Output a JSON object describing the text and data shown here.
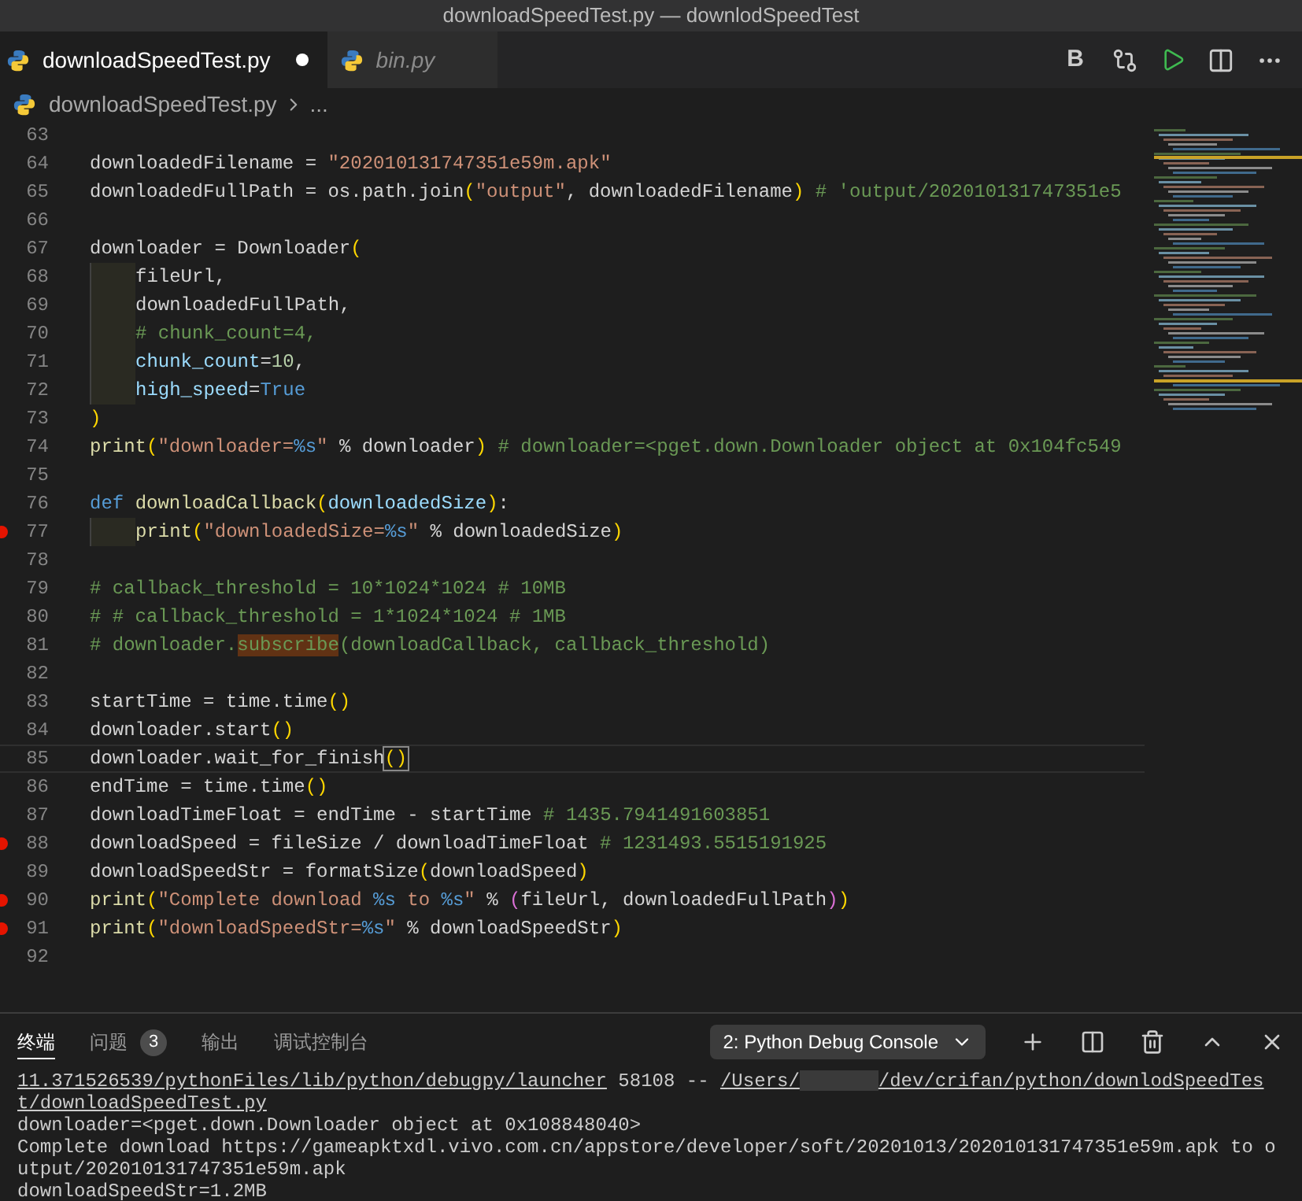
{
  "window": {
    "title": "downloadSpeedTest.py — downlodSpeedTest"
  },
  "tabs": [
    {
      "label": "downloadSpeedTest.py",
      "selected": true,
      "modified": true,
      "preview": false
    },
    {
      "label": "bin.py",
      "selected": false,
      "modified": false,
      "preview": true
    }
  ],
  "toolbar": {
    "bold_label": "B"
  },
  "breadcrumb": {
    "file": "downloadSpeedTest.py",
    "more": "..."
  },
  "editor": {
    "lines": [
      {
        "number": "63",
        "breakpoint": false,
        "current": false,
        "indent": false
      },
      {
        "number": "64",
        "breakpoint": false,
        "current": false,
        "indent": false,
        "tokens": [
          {
            "kind": "plain",
            "text": "downloadedFilename = "
          },
          {
            "kind": "string",
            "text": "\"202010131747351e59m.apk\""
          }
        ]
      },
      {
        "number": "65",
        "breakpoint": false,
        "current": false,
        "indent": false,
        "tokens": [
          {
            "kind": "plain",
            "text": "downloadedFullPath = os.path.join"
          },
          {
            "kind": "paren",
            "text": "("
          },
          {
            "kind": "string",
            "text": "\"output\""
          },
          {
            "kind": "plain",
            "text": ", downloadedFilename"
          },
          {
            "kind": "paren",
            "text": ")"
          },
          {
            "kind": "comment",
            "text": " # 'output/202010131747351e5"
          }
        ]
      },
      {
        "number": "66",
        "breakpoint": false,
        "current": false,
        "indent": false
      },
      {
        "number": "67",
        "breakpoint": false,
        "current": false,
        "indent": false,
        "tokens": [
          {
            "kind": "plain",
            "text": "downloader = Downloader"
          },
          {
            "kind": "paren",
            "text": "("
          }
        ]
      },
      {
        "number": "68",
        "breakpoint": false,
        "current": false,
        "indent": true,
        "tokens": [
          {
            "kind": "plain",
            "text": "fileUrl,"
          }
        ]
      },
      {
        "number": "69",
        "breakpoint": false,
        "current": false,
        "indent": true,
        "tokens": [
          {
            "kind": "plain",
            "text": "downloadedFullPath,"
          }
        ]
      },
      {
        "number": "70",
        "breakpoint": false,
        "current": false,
        "indent": true,
        "tokens": [
          {
            "kind": "comment",
            "text": "# chunk_count=4,"
          }
        ]
      },
      {
        "number": "71",
        "breakpoint": false,
        "current": false,
        "indent": true,
        "tokens": [
          {
            "kind": "param",
            "text": "chunk_count"
          },
          {
            "kind": "plain",
            "text": "="
          },
          {
            "kind": "number",
            "text": "10"
          },
          {
            "kind": "plain",
            "text": ","
          }
        ]
      },
      {
        "number": "72",
        "breakpoint": false,
        "current": false,
        "indent": true,
        "tokens": [
          {
            "kind": "param",
            "text": "high_speed"
          },
          {
            "kind": "plain",
            "text": "="
          },
          {
            "kind": "keyword",
            "text": "True"
          }
        ]
      },
      {
        "number": "73",
        "breakpoint": false,
        "current": false,
        "indent": false,
        "tokens": [
          {
            "kind": "paren",
            "text": ")"
          }
        ]
      },
      {
        "number": "74",
        "breakpoint": false,
        "current": false,
        "indent": false,
        "tokens": [
          {
            "kind": "func",
            "text": "print"
          },
          {
            "kind": "paren",
            "text": "("
          },
          {
            "kind": "string",
            "text": "\"downloader="
          },
          {
            "kind": "format",
            "text": "%s"
          },
          {
            "kind": "string",
            "text": "\""
          },
          {
            "kind": "plain",
            "text": " % downloader"
          },
          {
            "kind": "paren",
            "text": ")"
          },
          {
            "kind": "comment",
            "text": " # downloader=<pget.down.Downloader object at 0x104fc549"
          }
        ]
      },
      {
        "number": "75",
        "breakpoint": false,
        "current": false,
        "indent": false
      },
      {
        "number": "76",
        "breakpoint": false,
        "current": false,
        "indent": false,
        "tokens": [
          {
            "kind": "keyword",
            "text": "def "
          },
          {
            "kind": "func",
            "text": "downloadCallback"
          },
          {
            "kind": "paren",
            "text": "("
          },
          {
            "kind": "param",
            "text": "downloadedSize"
          },
          {
            "kind": "paren",
            "text": ")"
          },
          {
            "kind": "plain",
            "text": ":"
          }
        ]
      },
      {
        "number": "77",
        "breakpoint": true,
        "current": false,
        "indent": true,
        "tokens": [
          {
            "kind": "func",
            "text": "print"
          },
          {
            "kind": "paren",
            "text": "("
          },
          {
            "kind": "string",
            "text": "\"downloadedSize="
          },
          {
            "kind": "format",
            "text": "%s"
          },
          {
            "kind": "string",
            "text": "\""
          },
          {
            "kind": "plain",
            "text": " % downloadedSize"
          },
          {
            "kind": "paren",
            "text": ")"
          }
        ]
      },
      {
        "number": "78",
        "breakpoint": false,
        "current": false,
        "indent": false
      },
      {
        "number": "79",
        "breakpoint": false,
        "current": false,
        "indent": false,
        "tokens": [
          {
            "kind": "comment",
            "text": "# callback_threshold = 10*1024*1024 # 10MB"
          }
        ]
      },
      {
        "number": "80",
        "breakpoint": false,
        "current": false,
        "indent": false,
        "tokens": [
          {
            "kind": "comment",
            "text": "# # callback_threshold = 1*1024*1024 # 1MB"
          }
        ]
      },
      {
        "number": "81",
        "breakpoint": false,
        "current": false,
        "indent": false,
        "tokens": [
          {
            "kind": "comment",
            "text": "# downloader."
          },
          {
            "kind": "highlight",
            "text": "subscribe"
          },
          {
            "kind": "comment",
            "text": "(downloadCallback, callback_threshold)"
          }
        ]
      },
      {
        "number": "82",
        "breakpoint": false,
        "current": false,
        "indent": false
      },
      {
        "number": "83",
        "breakpoint": false,
        "current": false,
        "indent": false,
        "tokens": [
          {
            "kind": "plain",
            "text": "startTime = time.time"
          },
          {
            "kind": "paren",
            "text": "()"
          }
        ]
      },
      {
        "number": "84",
        "breakpoint": false,
        "current": false,
        "indent": false,
        "tokens": [
          {
            "kind": "plain",
            "text": "downloader.start"
          },
          {
            "kind": "paren",
            "text": "()"
          }
        ]
      },
      {
        "number": "85",
        "breakpoint": false,
        "current": true,
        "indent": false,
        "tokens": [
          {
            "kind": "plain",
            "text": "downloader.wait_for_finish"
          },
          {
            "kind": "match",
            "text": "()"
          }
        ]
      },
      {
        "number": "86",
        "breakpoint": false,
        "current": false,
        "indent": false,
        "tokens": [
          {
            "kind": "plain",
            "text": "endTime = time.time"
          },
          {
            "kind": "paren",
            "text": "()"
          }
        ]
      },
      {
        "number": "87",
        "breakpoint": false,
        "current": false,
        "indent": false,
        "tokens": [
          {
            "kind": "plain",
            "text": "downloadTimeFloat = endTime - startTime"
          },
          {
            "kind": "comment",
            "text": " # 1435.7941491603851"
          }
        ]
      },
      {
        "number": "88",
        "breakpoint": true,
        "current": false,
        "indent": false,
        "tokens": [
          {
            "kind": "plain",
            "text": "downloadSpeed = fileSize / downloadTimeFloat"
          },
          {
            "kind": "comment",
            "text": " # 1231493.5515191925"
          }
        ]
      },
      {
        "number": "89",
        "breakpoint": false,
        "current": false,
        "indent": false,
        "tokens": [
          {
            "kind": "plain",
            "text": "downloadSpeedStr = formatSize"
          },
          {
            "kind": "paren",
            "text": "("
          },
          {
            "kind": "plain",
            "text": "downloadSpeed"
          },
          {
            "kind": "paren",
            "text": ")"
          }
        ]
      },
      {
        "number": "90",
        "breakpoint": true,
        "current": false,
        "indent": false,
        "tokens": [
          {
            "kind": "func",
            "text": "print"
          },
          {
            "kind": "paren",
            "text": "("
          },
          {
            "kind": "string",
            "text": "\"Complete download "
          },
          {
            "kind": "format",
            "text": "%s"
          },
          {
            "kind": "string",
            "text": " to "
          },
          {
            "kind": "format",
            "text": "%s"
          },
          {
            "kind": "string",
            "text": "\""
          },
          {
            "kind": "plain",
            "text": " % "
          },
          {
            "kind": "paren2",
            "text": "("
          },
          {
            "kind": "plain",
            "text": "fileUrl, downloadedFullPath"
          },
          {
            "kind": "paren2",
            "text": ")"
          },
          {
            "kind": "paren",
            "text": ")"
          }
        ]
      },
      {
        "number": "91",
        "breakpoint": true,
        "current": false,
        "indent": false,
        "tokens": [
          {
            "kind": "func",
            "text": "print"
          },
          {
            "kind": "paren",
            "text": "("
          },
          {
            "kind": "string",
            "text": "\"downloadSpeedStr="
          },
          {
            "kind": "format",
            "text": "%s"
          },
          {
            "kind": "string",
            "text": "\""
          },
          {
            "kind": "plain",
            "text": " % downloadSpeedStr"
          },
          {
            "kind": "paren",
            "text": ")"
          }
        ]
      },
      {
        "number": "92",
        "breakpoint": false,
        "current": false,
        "indent": false
      }
    ]
  },
  "panel": {
    "tabs": [
      {
        "label": "终端",
        "selected": true
      },
      {
        "label": "问题",
        "selected": false,
        "badge": "3"
      },
      {
        "label": "输出",
        "selected": false
      },
      {
        "label": "调试控制台",
        "selected": false
      }
    ],
    "console_select": "2: Python Debug Console",
    "output": [
      {
        "segments": [
          {
            "kind": "link",
            "text": "11.371526539/pythonFiles/lib/python/debugpy/launcher"
          },
          {
            "kind": "text",
            "text": " 58108 -- "
          },
          {
            "kind": "link",
            "text": "/Users/"
          },
          {
            "kind": "redacted"
          },
          {
            "kind": "link",
            "text": "/dev/crifan/python/downlodSpeedTest/downloadSpeedTest.py"
          }
        ]
      },
      {
        "segments": [
          {
            "kind": "text",
            "text": "downloader=<pget.down.Downloader object at 0x108848040>"
          }
        ]
      },
      {
        "segments": [
          {
            "kind": "text",
            "text": "Complete download https://gameapktxdl.vivo.com.cn/appstore/developer/soft/20201013/202010131747351e59m.apk to output/202010131747351e59m.apk"
          }
        ]
      },
      {
        "segments": [
          {
            "kind": "text",
            "text": "downloadSpeedStr=1.2MB"
          }
        ]
      }
    ]
  }
}
